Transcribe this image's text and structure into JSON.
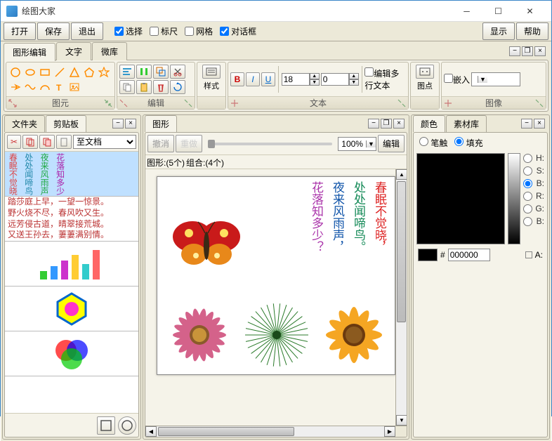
{
  "window": {
    "title": "绘图大家"
  },
  "menu": {
    "open": "打开",
    "save": "保存",
    "exit": "退出",
    "select": "选择",
    "ruler": "标尺",
    "grid": "网格",
    "dialog": "对话框",
    "display": "显示",
    "help": "帮助"
  },
  "ribbon": {
    "tabs": {
      "shape_edit": "图形编辑",
      "text": "文字",
      "micro_lib": "微库"
    },
    "groups": {
      "primitive": "图元",
      "edit": "编辑",
      "text": "文本",
      "image": "图像",
      "style": "样式",
      "dot": "图点",
      "embed": "嵌入",
      "multiline": "编辑多行文本"
    },
    "font_size": "18",
    "spacing": "0"
  },
  "left_panel": {
    "tabs": {
      "folder": "文件夹",
      "clipboard": "剪贴板"
    },
    "to_doc": "至文档",
    "poem_lines": [
      "春眠不觉晓",
      "处处闻啼鸟",
      "夜来风雨声",
      "花落知多少"
    ],
    "text_lines": [
      "踏莎庭上早，一望一惊景。",
      "野火烧不尽，春风吹又生。",
      "远芳侵古道，晴翠接荒城。",
      "又送王孙去，萋萋满别情。"
    ]
  },
  "center_panel": {
    "tab": "图形",
    "undo": "撤消",
    "redo": "重做",
    "zoom": "100%",
    "edit": "编辑",
    "shapes_tab": "图形:(5个)",
    "groups_tab": "组合:(4个)",
    "poem": {
      "line1": "春眠不觉晓，",
      "line2": "处处闻啼鸟。",
      "line3": "夜来风雨声，",
      "line4": "花落知多少？"
    }
  },
  "right_panel": {
    "tabs": {
      "color": "颜色",
      "material": "素材库"
    },
    "stroke": "笔触",
    "fill": "填充",
    "labels": {
      "h": "H:",
      "s": "S:",
      "b": "B:",
      "r": "R:",
      "g": "G:",
      "b2": "B:",
      "a": "A:"
    },
    "hex": "000000",
    "hash": "#"
  }
}
